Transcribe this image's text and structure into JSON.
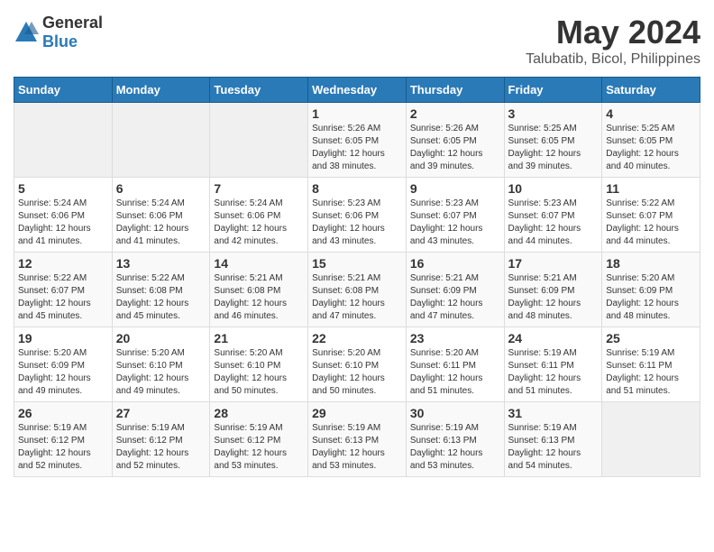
{
  "header": {
    "logo_general": "General",
    "logo_blue": "Blue",
    "title": "May 2024",
    "subtitle": "Talubatib, Bicol, Philippines"
  },
  "calendar": {
    "days_of_week": [
      "Sunday",
      "Monday",
      "Tuesday",
      "Wednesday",
      "Thursday",
      "Friday",
      "Saturday"
    ],
    "weeks": [
      [
        {
          "day": "",
          "info": ""
        },
        {
          "day": "",
          "info": ""
        },
        {
          "day": "",
          "info": ""
        },
        {
          "day": "1",
          "info": "Sunrise: 5:26 AM\nSunset: 6:05 PM\nDaylight: 12 hours\nand 38 minutes."
        },
        {
          "day": "2",
          "info": "Sunrise: 5:26 AM\nSunset: 6:05 PM\nDaylight: 12 hours\nand 39 minutes."
        },
        {
          "day": "3",
          "info": "Sunrise: 5:25 AM\nSunset: 6:05 PM\nDaylight: 12 hours\nand 39 minutes."
        },
        {
          "day": "4",
          "info": "Sunrise: 5:25 AM\nSunset: 6:05 PM\nDaylight: 12 hours\nand 40 minutes."
        }
      ],
      [
        {
          "day": "5",
          "info": "Sunrise: 5:24 AM\nSunset: 6:06 PM\nDaylight: 12 hours\nand 41 minutes."
        },
        {
          "day": "6",
          "info": "Sunrise: 5:24 AM\nSunset: 6:06 PM\nDaylight: 12 hours\nand 41 minutes."
        },
        {
          "day": "7",
          "info": "Sunrise: 5:24 AM\nSunset: 6:06 PM\nDaylight: 12 hours\nand 42 minutes."
        },
        {
          "day": "8",
          "info": "Sunrise: 5:23 AM\nSunset: 6:06 PM\nDaylight: 12 hours\nand 43 minutes."
        },
        {
          "day": "9",
          "info": "Sunrise: 5:23 AM\nSunset: 6:07 PM\nDaylight: 12 hours\nand 43 minutes."
        },
        {
          "day": "10",
          "info": "Sunrise: 5:23 AM\nSunset: 6:07 PM\nDaylight: 12 hours\nand 44 minutes."
        },
        {
          "day": "11",
          "info": "Sunrise: 5:22 AM\nSunset: 6:07 PM\nDaylight: 12 hours\nand 44 minutes."
        }
      ],
      [
        {
          "day": "12",
          "info": "Sunrise: 5:22 AM\nSunset: 6:07 PM\nDaylight: 12 hours\nand 45 minutes."
        },
        {
          "day": "13",
          "info": "Sunrise: 5:22 AM\nSunset: 6:08 PM\nDaylight: 12 hours\nand 45 minutes."
        },
        {
          "day": "14",
          "info": "Sunrise: 5:21 AM\nSunset: 6:08 PM\nDaylight: 12 hours\nand 46 minutes."
        },
        {
          "day": "15",
          "info": "Sunrise: 5:21 AM\nSunset: 6:08 PM\nDaylight: 12 hours\nand 47 minutes."
        },
        {
          "day": "16",
          "info": "Sunrise: 5:21 AM\nSunset: 6:09 PM\nDaylight: 12 hours\nand 47 minutes."
        },
        {
          "day": "17",
          "info": "Sunrise: 5:21 AM\nSunset: 6:09 PM\nDaylight: 12 hours\nand 48 minutes."
        },
        {
          "day": "18",
          "info": "Sunrise: 5:20 AM\nSunset: 6:09 PM\nDaylight: 12 hours\nand 48 minutes."
        }
      ],
      [
        {
          "day": "19",
          "info": "Sunrise: 5:20 AM\nSunset: 6:09 PM\nDaylight: 12 hours\nand 49 minutes."
        },
        {
          "day": "20",
          "info": "Sunrise: 5:20 AM\nSunset: 6:10 PM\nDaylight: 12 hours\nand 49 minutes."
        },
        {
          "day": "21",
          "info": "Sunrise: 5:20 AM\nSunset: 6:10 PM\nDaylight: 12 hours\nand 50 minutes."
        },
        {
          "day": "22",
          "info": "Sunrise: 5:20 AM\nSunset: 6:10 PM\nDaylight: 12 hours\nand 50 minutes."
        },
        {
          "day": "23",
          "info": "Sunrise: 5:20 AM\nSunset: 6:11 PM\nDaylight: 12 hours\nand 51 minutes."
        },
        {
          "day": "24",
          "info": "Sunrise: 5:19 AM\nSunset: 6:11 PM\nDaylight: 12 hours\nand 51 minutes."
        },
        {
          "day": "25",
          "info": "Sunrise: 5:19 AM\nSunset: 6:11 PM\nDaylight: 12 hours\nand 51 minutes."
        }
      ],
      [
        {
          "day": "26",
          "info": "Sunrise: 5:19 AM\nSunset: 6:12 PM\nDaylight: 12 hours\nand 52 minutes."
        },
        {
          "day": "27",
          "info": "Sunrise: 5:19 AM\nSunset: 6:12 PM\nDaylight: 12 hours\nand 52 minutes."
        },
        {
          "day": "28",
          "info": "Sunrise: 5:19 AM\nSunset: 6:12 PM\nDaylight: 12 hours\nand 53 minutes."
        },
        {
          "day": "29",
          "info": "Sunrise: 5:19 AM\nSunset: 6:13 PM\nDaylight: 12 hours\nand 53 minutes."
        },
        {
          "day": "30",
          "info": "Sunrise: 5:19 AM\nSunset: 6:13 PM\nDaylight: 12 hours\nand 53 minutes."
        },
        {
          "day": "31",
          "info": "Sunrise: 5:19 AM\nSunset: 6:13 PM\nDaylight: 12 hours\nand 54 minutes."
        },
        {
          "day": "",
          "info": ""
        }
      ]
    ]
  }
}
